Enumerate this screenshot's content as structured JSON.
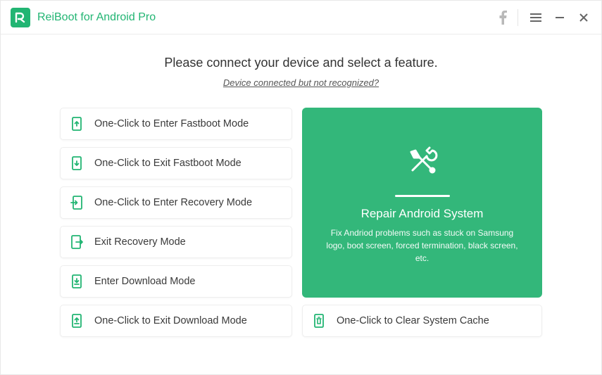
{
  "app": {
    "title": "ReiBoot for Android Pro"
  },
  "titlebar": {
    "facebook_icon": "facebook-icon",
    "menu_icon": "menu-icon",
    "minimize_icon": "minimize-icon",
    "close_icon": "close-icon"
  },
  "main": {
    "heading": "Please connect your device and select a feature.",
    "subheading": "Device connected but not recognized?"
  },
  "options": [
    {
      "id": "enter-fastboot",
      "icon": "phone-up-icon",
      "label": "One-Click to Enter Fastboot Mode"
    },
    {
      "id": "exit-fastboot",
      "icon": "phone-down-icon",
      "label": "One-Click to Exit Fastboot Mode"
    },
    {
      "id": "enter-recovery",
      "icon": "phone-arrow-in-icon",
      "label": "One-Click to Enter Recovery Mode"
    },
    {
      "id": "exit-recovery",
      "icon": "phone-arrow-out-icon",
      "label": "Exit Recovery Mode"
    },
    {
      "id": "enter-download",
      "icon": "phone-download-icon",
      "label": "Enter Download Mode"
    },
    {
      "id": "exit-download",
      "icon": "phone-upload-icon",
      "label": "One-Click to Exit Download Mode"
    }
  ],
  "repair": {
    "title": "Repair Android System",
    "description": "Fix Andriod problems such as stuck on Samsung logo, boot screen, forced termination, black screen, etc."
  },
  "clear_cache": {
    "icon": "phone-trash-icon",
    "label": "One-Click to Clear System Cache"
  },
  "colors": {
    "accent": "#22b573",
    "repair_bg": "#33b77a"
  }
}
